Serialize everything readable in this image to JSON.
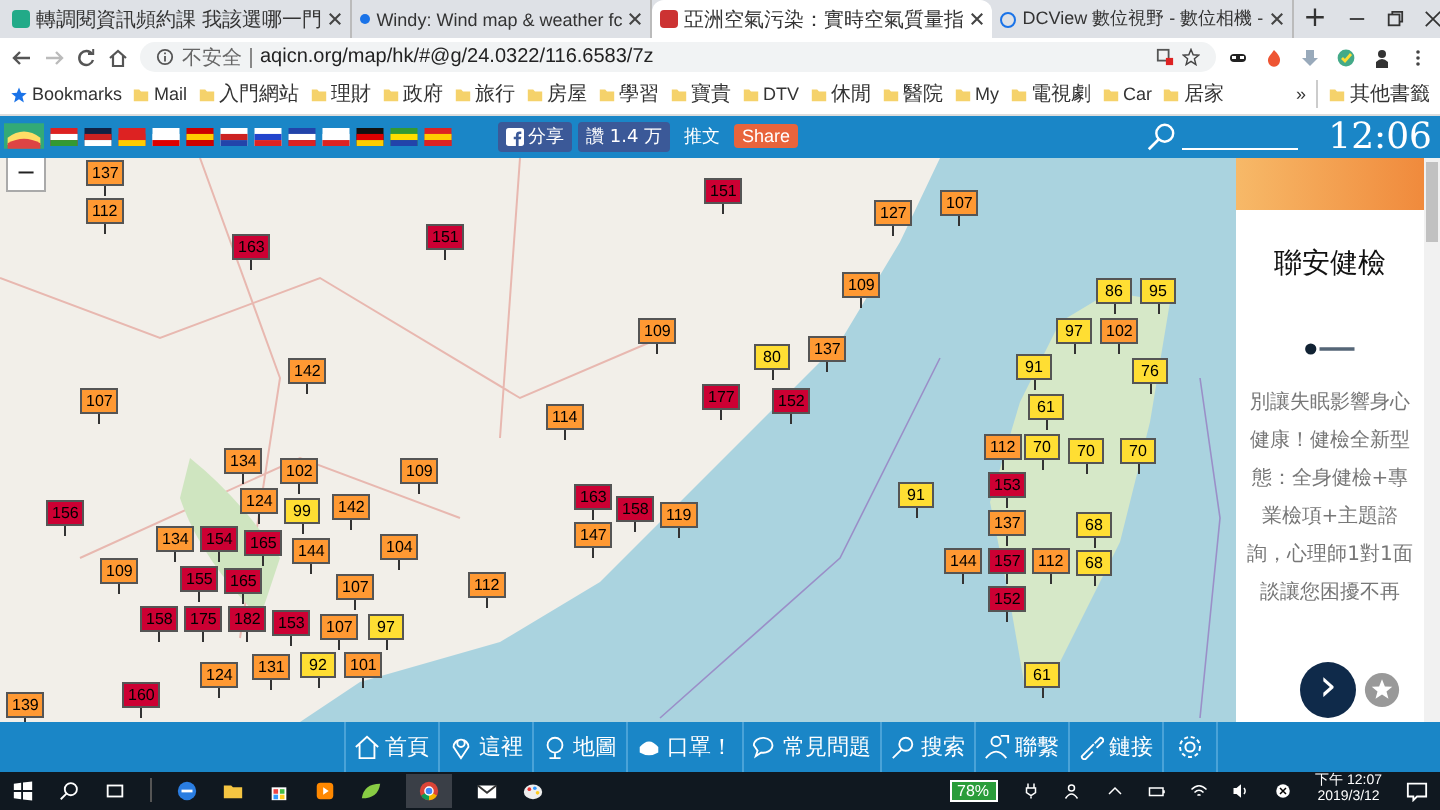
{
  "browser": {
    "tabs": [
      {
        "title": "轉調閱資訊頻約課 我該選哪一門",
        "selected": false
      },
      {
        "title": "Windy: Wind map & weather fc",
        "selected": false
      },
      {
        "title": "亞洲空氣污染：實時空氣質量指",
        "selected": true
      },
      {
        "title": "DCView 數位視野 - 數位相機 -",
        "selected": false
      }
    ],
    "new_tab": "+",
    "security": "不安全",
    "url": "aqicn.org/map/hk/#@g/24.0322/116.6583/7z",
    "bookmarks": [
      "Bookmarks",
      "Mail",
      "入門網站",
      "理財",
      "政府",
      "旅行",
      "房屋",
      "學習",
      "寶貴",
      "DTV",
      "休閒",
      "醫院",
      "My",
      "電視劇",
      "Car",
      "居家"
    ],
    "more_bookmarks": "»",
    "other_bookmarks": "其他書籤"
  },
  "site_bar": {
    "share": "分享",
    "like": "讚 1.4 万",
    "tweet": "推文",
    "share_button": "Share",
    "clock": "12:06"
  },
  "map": {
    "zoom_out": "−",
    "markers": [
      {
        "value": "137",
        "color": "#ff9933"
      },
      {
        "value": "112",
        "color": "#ff9933"
      },
      {
        "value": "163",
        "color": "#cc0033"
      },
      {
        "value": "151",
        "color": "#cc0033"
      },
      {
        "value": "142",
        "color": "#ff9933"
      },
      {
        "value": "107",
        "color": "#ff9933"
      },
      {
        "value": "114",
        "color": "#ff9933"
      },
      {
        "value": "134",
        "color": "#ff9933"
      },
      {
        "value": "102",
        "color": "#ff9933"
      },
      {
        "value": "109",
        "color": "#ff9933"
      },
      {
        "value": "156",
        "color": "#cc0033"
      },
      {
        "value": "124",
        "color": "#ff9933"
      },
      {
        "value": "99",
        "color": "#ffde33"
      },
      {
        "value": "142",
        "color": "#ff9933"
      },
      {
        "value": "104",
        "color": "#ff9933"
      },
      {
        "value": "134",
        "color": "#ff9933"
      },
      {
        "value": "154",
        "color": "#cc0033"
      },
      {
        "value": "165",
        "color": "#cc0033"
      },
      {
        "value": "144",
        "color": "#ff9933"
      },
      {
        "value": "109",
        "color": "#ff9933"
      },
      {
        "value": "155",
        "color": "#cc0033"
      },
      {
        "value": "165",
        "color": "#cc0033"
      },
      {
        "value": "175",
        "color": "#cc0033"
      },
      {
        "value": "107",
        "color": "#ff9933"
      },
      {
        "value": "112",
        "color": "#ff9933"
      },
      {
        "value": "158",
        "color": "#cc0033"
      },
      {
        "value": "182",
        "color": "#cc0033"
      },
      {
        "value": "153",
        "color": "#cc0033"
      },
      {
        "value": "107",
        "color": "#ff9933"
      },
      {
        "value": "97",
        "color": "#ffde33"
      },
      {
        "value": "92",
        "color": "#ffde33"
      },
      {
        "value": "101",
        "color": "#ff9933"
      },
      {
        "value": "124",
        "color": "#ff9933"
      },
      {
        "value": "131",
        "color": "#ff9933"
      },
      {
        "value": "160",
        "color": "#cc0033"
      },
      {
        "value": "139",
        "color": "#ff9933"
      },
      {
        "value": "163",
        "color": "#cc0033"
      },
      {
        "value": "147",
        "color": "#ff9933"
      },
      {
        "value": "151",
        "color": "#cc0033"
      },
      {
        "value": "127",
        "color": "#ff9933"
      },
      {
        "value": "107",
        "color": "#ff9933"
      },
      {
        "value": "109",
        "color": "#ff9933"
      },
      {
        "value": "109",
        "color": "#ff9933"
      },
      {
        "value": "80",
        "color": "#ffde33"
      },
      {
        "value": "137",
        "color": "#ff9933"
      },
      {
        "value": "177",
        "color": "#cc0033"
      },
      {
        "value": "152",
        "color": "#cc0033"
      },
      {
        "value": "158",
        "color": "#cc0033"
      },
      {
        "value": "119",
        "color": "#ff9933"
      },
      {
        "value": "91",
        "color": "#ffde33"
      },
      {
        "value": "86",
        "color": "#ffde33"
      },
      {
        "value": "95",
        "color": "#ffde33"
      },
      {
        "value": "97",
        "color": "#ffde33"
      },
      {
        "value": "102",
        "color": "#ff9933"
      },
      {
        "value": "91",
        "color": "#ffde33"
      },
      {
        "value": "76",
        "color": "#ffde33"
      },
      {
        "value": "61",
        "color": "#ffde33"
      },
      {
        "value": "112",
        "color": "#ff9933"
      },
      {
        "value": "70",
        "color": "#ffde33"
      },
      {
        "value": "70",
        "color": "#ffde33"
      },
      {
        "value": "70",
        "color": "#ffde33"
      },
      {
        "value": "153",
        "color": "#cc0033"
      },
      {
        "value": "137",
        "color": "#ff9933"
      },
      {
        "value": "144",
        "color": "#ff9933"
      },
      {
        "value": "157",
        "color": "#cc0033"
      },
      {
        "value": "112",
        "color": "#ff9933"
      },
      {
        "value": "68",
        "color": "#ffde33"
      },
      {
        "value": "68",
        "color": "#ffde33"
      },
      {
        "value": "152",
        "color": "#cc0033"
      },
      {
        "value": "61",
        "color": "#ffde33"
      }
    ]
  },
  "ad": {
    "title": "聯安健檢",
    "body": "別讓失眠影響身心健康！健檢全新型態：全身健檢+專業檢項+主題諮詢，心理師1對1面談讓您困擾不再",
    "next": "›"
  },
  "nav": [
    {
      "label": "首頁"
    },
    {
      "label": "這裡"
    },
    {
      "label": "地圖"
    },
    {
      "label": "口罩！"
    },
    {
      "label": "常見問題"
    },
    {
      "label": "搜索"
    },
    {
      "label": "聯繫"
    },
    {
      "label": "鏈接"
    }
  ],
  "taskbar": {
    "battery": "78%",
    "time": "下午 12:07",
    "date": "2019/3/12"
  }
}
